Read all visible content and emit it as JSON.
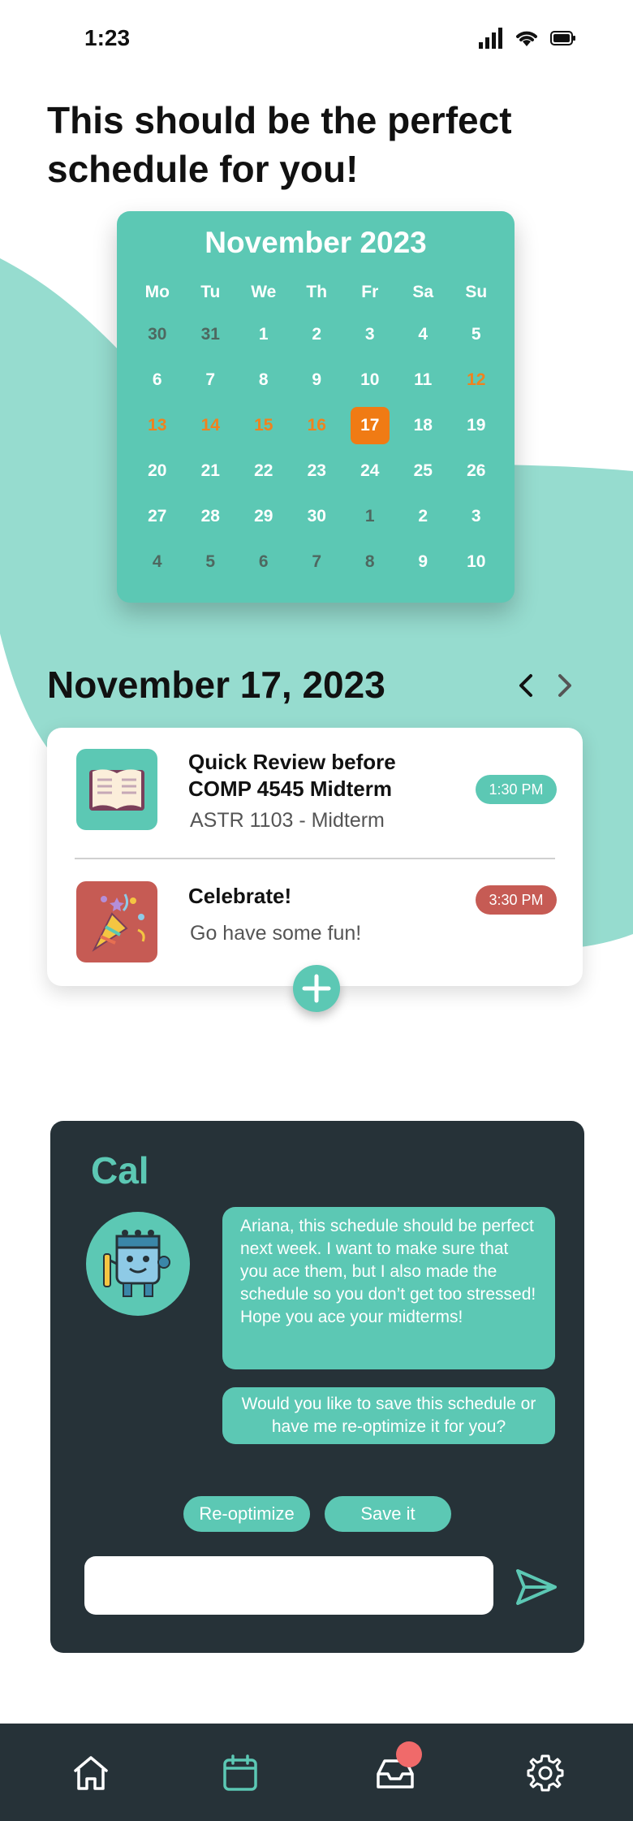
{
  "status_bar": {
    "time": "1:23",
    "icons": [
      "signal-icon",
      "wifi-icon",
      "battery-icon"
    ]
  },
  "headline": "This should be the perfect schedule for you!",
  "calendar": {
    "month_title": "November 2023",
    "weekdays": [
      "Mo",
      "Tu",
      "We",
      "Th",
      "Fr",
      "Sa",
      "Su"
    ],
    "weeks": [
      [
        {
          "d": "30",
          "s": "dim"
        },
        {
          "d": "31",
          "s": "dim"
        },
        {
          "d": "1",
          "s": "normal"
        },
        {
          "d": "2",
          "s": "normal"
        },
        {
          "d": "3",
          "s": "normal"
        },
        {
          "d": "4",
          "s": "normal"
        },
        {
          "d": "5",
          "s": "normal"
        }
      ],
      [
        {
          "d": "6",
          "s": "normal"
        },
        {
          "d": "7",
          "s": "normal"
        },
        {
          "d": "8",
          "s": "normal"
        },
        {
          "d": "9",
          "s": "normal"
        },
        {
          "d": "10",
          "s": "normal"
        },
        {
          "d": "11",
          "s": "normal"
        },
        {
          "d": "12",
          "s": "orange"
        }
      ],
      [
        {
          "d": "13",
          "s": "orange"
        },
        {
          "d": "14",
          "s": "orange"
        },
        {
          "d": "15",
          "s": "orange"
        },
        {
          "d": "16",
          "s": "orange"
        },
        {
          "d": "17",
          "s": "selected"
        },
        {
          "d": "18",
          "s": "normal"
        },
        {
          "d": "19",
          "s": "normal"
        }
      ],
      [
        {
          "d": "20",
          "s": "normal"
        },
        {
          "d": "21",
          "s": "normal"
        },
        {
          "d": "22",
          "s": "normal"
        },
        {
          "d": "23",
          "s": "normal"
        },
        {
          "d": "24",
          "s": "normal"
        },
        {
          "d": "25",
          "s": "normal"
        },
        {
          "d": "26",
          "s": "normal"
        }
      ],
      [
        {
          "d": "27",
          "s": "normal"
        },
        {
          "d": "28",
          "s": "normal"
        },
        {
          "d": "29",
          "s": "normal"
        },
        {
          "d": "30",
          "s": "normal"
        },
        {
          "d": "1",
          "s": "dim"
        },
        {
          "d": "2",
          "s": "normal"
        },
        {
          "d": "3",
          "s": "normal"
        }
      ],
      [
        {
          "d": "4",
          "s": "dim"
        },
        {
          "d": "5",
          "s": "dim"
        },
        {
          "d": "6",
          "s": "dim"
        },
        {
          "d": "7",
          "s": "dim"
        },
        {
          "d": "8",
          "s": "dim"
        },
        {
          "d": "9",
          "s": "normal"
        },
        {
          "d": "10",
          "s": "normal"
        }
      ]
    ],
    "selected_day": "17"
  },
  "schedule": {
    "date_heading": "November 17, 2023",
    "prev_icon": "chevron-left-icon",
    "next_icon": "chevron-right-icon",
    "events": [
      {
        "icon": "book-icon",
        "title": "Quick Review before COMP 4545 Midterm",
        "subtitle": "ASTR 1103 - Midterm",
        "time": "1:30 PM",
        "time_color": "#5cc8b4"
      },
      {
        "icon": "party-popper-icon",
        "title": "Celebrate!",
        "subtitle": "Go have some fun!",
        "time": "3:30 PM",
        "time_color": "#c65b54"
      }
    ],
    "add_icon": "plus-icon"
  },
  "assistant": {
    "name": "Cal",
    "avatar_icon": "calendar-robot-icon",
    "messages": [
      "Ariana, this schedule should be perfect next week. I want to make sure that you ace them, but I also made the schedule so you don’t get too stressed! Hope you ace your midterms!",
      "Would you like to save this schedule or have me re-optimize it for you?"
    ],
    "actions": {
      "reoptimize_label": "Re-optimize",
      "save_label": "Save it"
    },
    "input": {
      "value": "",
      "placeholder": ""
    },
    "send_icon": "send-icon"
  },
  "tab_bar": {
    "tabs": [
      {
        "icon": "home-icon",
        "active": false
      },
      {
        "icon": "calendar-icon",
        "active": true
      },
      {
        "icon": "inbox-icon",
        "active": false,
        "has_badge": true
      },
      {
        "icon": "gear-icon",
        "active": false
      }
    ]
  },
  "colors": {
    "accent": "#5cc8b4",
    "dark_panel": "#263238",
    "highlight": "#f07b14",
    "badge": "#f06a6a",
    "blob": "#96dccf"
  }
}
